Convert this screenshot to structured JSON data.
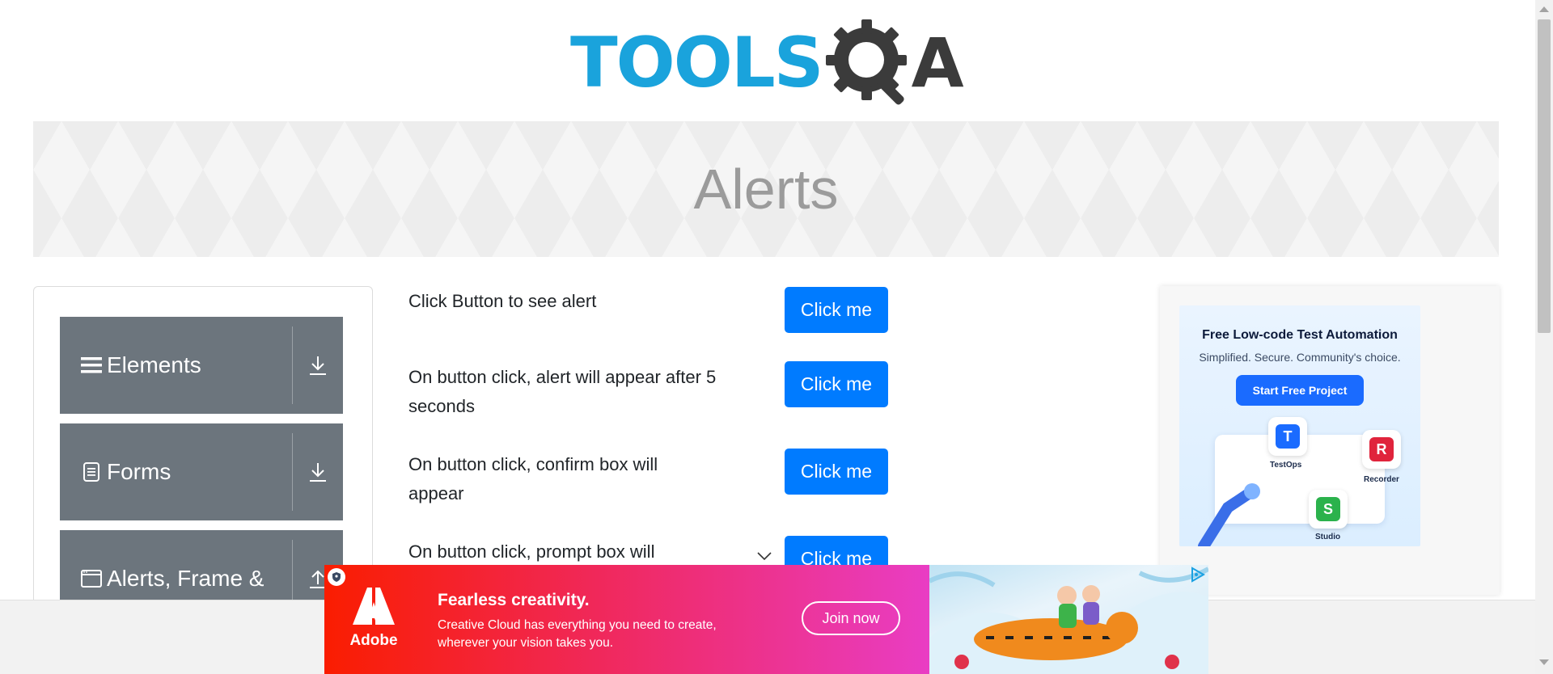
{
  "header": {
    "logo_text": "TOOLS",
    "logo_letter": "A",
    "logo_colors": {
      "tools": "#1aa3dc",
      "qa": "#3b3b3b"
    }
  },
  "banner": {
    "title": "Alerts"
  },
  "sidebar": {
    "groups": [
      {
        "label": "Elements",
        "icon": "hamburger-icon",
        "toggle_icon": "download-arrow-icon"
      },
      {
        "label": "Forms",
        "icon": "document-icon",
        "toggle_icon": "download-arrow-icon"
      },
      {
        "label": "Alerts, Frame &",
        "icon": "window-icon",
        "toggle_icon": "upload-arrow-icon"
      }
    ],
    "group_color": "#6c757d"
  },
  "alerts": {
    "rows": [
      {
        "text": "Click Button to see alert",
        "button": "Click me"
      },
      {
        "text": "On button click, alert will appear after 5 seconds",
        "button": "Click me"
      },
      {
        "text": "On button click, confirm box will appear",
        "button": "Click me"
      },
      {
        "text": "On button click, prompt box will",
        "button": "Click me"
      }
    ],
    "button_color": "#007bff"
  },
  "right_ad": {
    "title": "Free Low-code Test Automation",
    "subtitle": "Simplified. Secure. Community's choice.",
    "cta": "Start Free Project",
    "products": [
      {
        "name": "TestOps",
        "letter": "T",
        "color": "#1a6bff"
      },
      {
        "name": "Recorder",
        "letter": "R",
        "color": "#e0243c"
      },
      {
        "name": "Studio",
        "letter": "S",
        "color": "#2bb24c"
      }
    ]
  },
  "bottom_ad": {
    "brand": "Adobe",
    "title": "Fearless creativity.",
    "text": "Creative Cloud has everything you need to create, wherever your vision takes you.",
    "cta": "Join now"
  }
}
